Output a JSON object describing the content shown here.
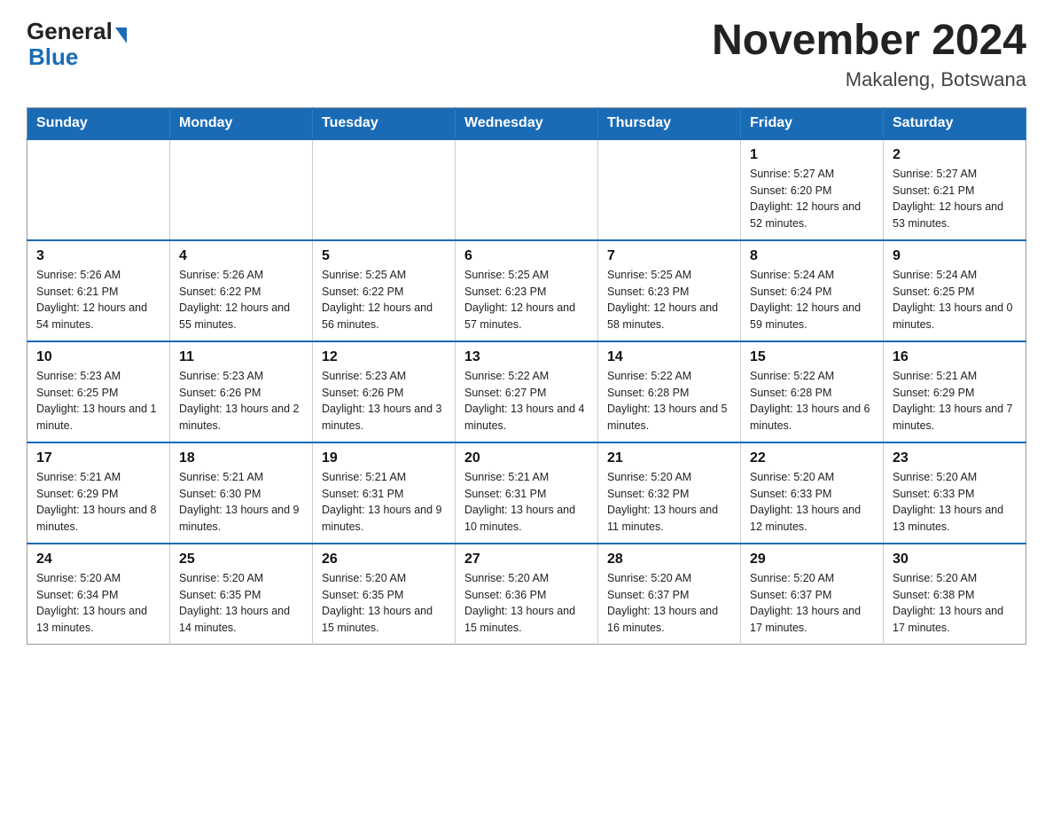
{
  "header": {
    "logo": {
      "general": "General",
      "blue": "Blue"
    },
    "title": "November 2024",
    "subtitle": "Makaleng, Botswana"
  },
  "weekdays": [
    "Sunday",
    "Monday",
    "Tuesday",
    "Wednesday",
    "Thursday",
    "Friday",
    "Saturday"
  ],
  "weeks": [
    [
      {
        "day": "",
        "sunrise": "",
        "sunset": "",
        "daylight": ""
      },
      {
        "day": "",
        "sunrise": "",
        "sunset": "",
        "daylight": ""
      },
      {
        "day": "",
        "sunrise": "",
        "sunset": "",
        "daylight": ""
      },
      {
        "day": "",
        "sunrise": "",
        "sunset": "",
        "daylight": ""
      },
      {
        "day": "",
        "sunrise": "",
        "sunset": "",
        "daylight": ""
      },
      {
        "day": "1",
        "sunrise": "Sunrise: 5:27 AM",
        "sunset": "Sunset: 6:20 PM",
        "daylight": "Daylight: 12 hours and 52 minutes."
      },
      {
        "day": "2",
        "sunrise": "Sunrise: 5:27 AM",
        "sunset": "Sunset: 6:21 PM",
        "daylight": "Daylight: 12 hours and 53 minutes."
      }
    ],
    [
      {
        "day": "3",
        "sunrise": "Sunrise: 5:26 AM",
        "sunset": "Sunset: 6:21 PM",
        "daylight": "Daylight: 12 hours and 54 minutes."
      },
      {
        "day": "4",
        "sunrise": "Sunrise: 5:26 AM",
        "sunset": "Sunset: 6:22 PM",
        "daylight": "Daylight: 12 hours and 55 minutes."
      },
      {
        "day": "5",
        "sunrise": "Sunrise: 5:25 AM",
        "sunset": "Sunset: 6:22 PM",
        "daylight": "Daylight: 12 hours and 56 minutes."
      },
      {
        "day": "6",
        "sunrise": "Sunrise: 5:25 AM",
        "sunset": "Sunset: 6:23 PM",
        "daylight": "Daylight: 12 hours and 57 minutes."
      },
      {
        "day": "7",
        "sunrise": "Sunrise: 5:25 AM",
        "sunset": "Sunset: 6:23 PM",
        "daylight": "Daylight: 12 hours and 58 minutes."
      },
      {
        "day": "8",
        "sunrise": "Sunrise: 5:24 AM",
        "sunset": "Sunset: 6:24 PM",
        "daylight": "Daylight: 12 hours and 59 minutes."
      },
      {
        "day": "9",
        "sunrise": "Sunrise: 5:24 AM",
        "sunset": "Sunset: 6:25 PM",
        "daylight": "Daylight: 13 hours and 0 minutes."
      }
    ],
    [
      {
        "day": "10",
        "sunrise": "Sunrise: 5:23 AM",
        "sunset": "Sunset: 6:25 PM",
        "daylight": "Daylight: 13 hours and 1 minute."
      },
      {
        "day": "11",
        "sunrise": "Sunrise: 5:23 AM",
        "sunset": "Sunset: 6:26 PM",
        "daylight": "Daylight: 13 hours and 2 minutes."
      },
      {
        "day": "12",
        "sunrise": "Sunrise: 5:23 AM",
        "sunset": "Sunset: 6:26 PM",
        "daylight": "Daylight: 13 hours and 3 minutes."
      },
      {
        "day": "13",
        "sunrise": "Sunrise: 5:22 AM",
        "sunset": "Sunset: 6:27 PM",
        "daylight": "Daylight: 13 hours and 4 minutes."
      },
      {
        "day": "14",
        "sunrise": "Sunrise: 5:22 AM",
        "sunset": "Sunset: 6:28 PM",
        "daylight": "Daylight: 13 hours and 5 minutes."
      },
      {
        "day": "15",
        "sunrise": "Sunrise: 5:22 AM",
        "sunset": "Sunset: 6:28 PM",
        "daylight": "Daylight: 13 hours and 6 minutes."
      },
      {
        "day": "16",
        "sunrise": "Sunrise: 5:21 AM",
        "sunset": "Sunset: 6:29 PM",
        "daylight": "Daylight: 13 hours and 7 minutes."
      }
    ],
    [
      {
        "day": "17",
        "sunrise": "Sunrise: 5:21 AM",
        "sunset": "Sunset: 6:29 PM",
        "daylight": "Daylight: 13 hours and 8 minutes."
      },
      {
        "day": "18",
        "sunrise": "Sunrise: 5:21 AM",
        "sunset": "Sunset: 6:30 PM",
        "daylight": "Daylight: 13 hours and 9 minutes."
      },
      {
        "day": "19",
        "sunrise": "Sunrise: 5:21 AM",
        "sunset": "Sunset: 6:31 PM",
        "daylight": "Daylight: 13 hours and 9 minutes."
      },
      {
        "day": "20",
        "sunrise": "Sunrise: 5:21 AM",
        "sunset": "Sunset: 6:31 PM",
        "daylight": "Daylight: 13 hours and 10 minutes."
      },
      {
        "day": "21",
        "sunrise": "Sunrise: 5:20 AM",
        "sunset": "Sunset: 6:32 PM",
        "daylight": "Daylight: 13 hours and 11 minutes."
      },
      {
        "day": "22",
        "sunrise": "Sunrise: 5:20 AM",
        "sunset": "Sunset: 6:33 PM",
        "daylight": "Daylight: 13 hours and 12 minutes."
      },
      {
        "day": "23",
        "sunrise": "Sunrise: 5:20 AM",
        "sunset": "Sunset: 6:33 PM",
        "daylight": "Daylight: 13 hours and 13 minutes."
      }
    ],
    [
      {
        "day": "24",
        "sunrise": "Sunrise: 5:20 AM",
        "sunset": "Sunset: 6:34 PM",
        "daylight": "Daylight: 13 hours and 13 minutes."
      },
      {
        "day": "25",
        "sunrise": "Sunrise: 5:20 AM",
        "sunset": "Sunset: 6:35 PM",
        "daylight": "Daylight: 13 hours and 14 minutes."
      },
      {
        "day": "26",
        "sunrise": "Sunrise: 5:20 AM",
        "sunset": "Sunset: 6:35 PM",
        "daylight": "Daylight: 13 hours and 15 minutes."
      },
      {
        "day": "27",
        "sunrise": "Sunrise: 5:20 AM",
        "sunset": "Sunset: 6:36 PM",
        "daylight": "Daylight: 13 hours and 15 minutes."
      },
      {
        "day": "28",
        "sunrise": "Sunrise: 5:20 AM",
        "sunset": "Sunset: 6:37 PM",
        "daylight": "Daylight: 13 hours and 16 minutes."
      },
      {
        "day": "29",
        "sunrise": "Sunrise: 5:20 AM",
        "sunset": "Sunset: 6:37 PM",
        "daylight": "Daylight: 13 hours and 17 minutes."
      },
      {
        "day": "30",
        "sunrise": "Sunrise: 5:20 AM",
        "sunset": "Sunset: 6:38 PM",
        "daylight": "Daylight: 13 hours and 17 minutes."
      }
    ]
  ]
}
